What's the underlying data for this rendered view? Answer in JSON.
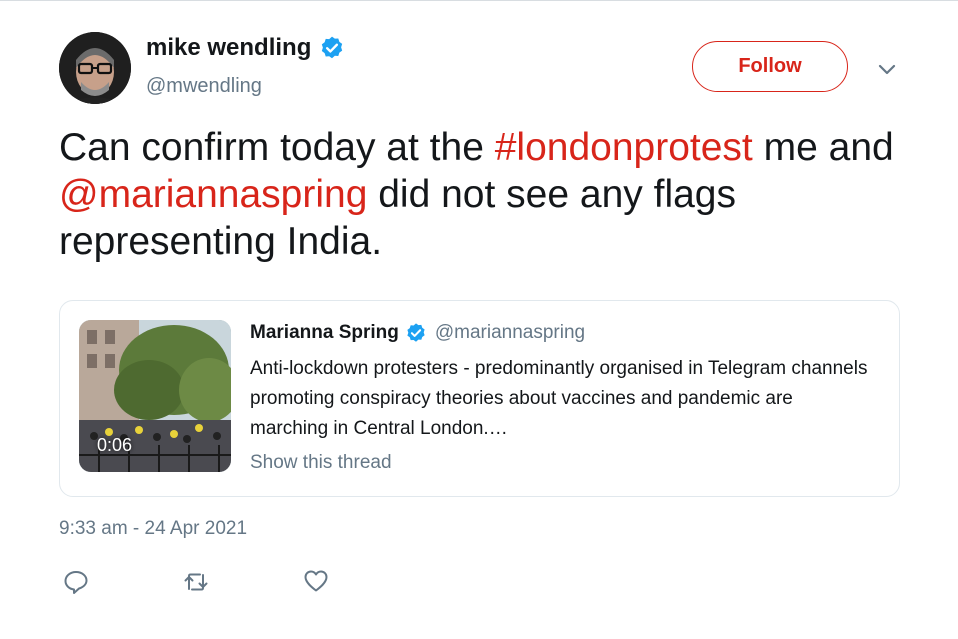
{
  "tweet": {
    "author": {
      "name": "mike wendling",
      "handle": "@mwendling",
      "verified_icon": "verified-badge-icon"
    },
    "follow_label": "Follow",
    "menu_icon": "chevron-down-icon",
    "text_parts": {
      "p1": "Can confirm today at the ",
      "hashtag": "#londonprotest",
      "p2": " me and ",
      "mention": "@mariannaspring",
      "p3": " did not see any flags representing India."
    },
    "quote": {
      "name": "Marianna Spring",
      "handle": "@mariannaspring",
      "text": "Anti-lockdown protesters - predominantly organised in Telegram channels promoting conspiracy theories about vaccines and pandemic are marching in Central London.…",
      "show_thread": "Show this thread",
      "video_duration": "0:06"
    },
    "timestamp": "9:33 am - 24 Apr 2021",
    "actions": [
      "reply-icon",
      "retweet-icon",
      "like-icon"
    ]
  },
  "colors": {
    "accent": "#d8251a",
    "verified": "#1da1f2",
    "secondary_text": "#657786",
    "border": "#e1e8ed"
  }
}
